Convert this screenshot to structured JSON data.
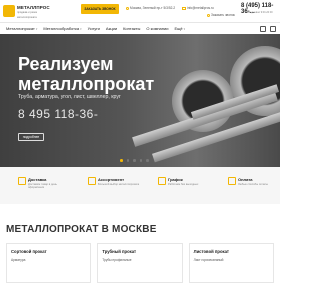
{
  "header": {
    "logo_name": "МЕТАЛЛПРОС",
    "logo_sub": "продажа и резка металлопроката",
    "cta_label": "ЗАКАЗАТЬ ЗВОНОК",
    "address": "Москва, Зеленый пр-т 5/3/52-2",
    "email": "info@metallpros.ru",
    "callback_label": "Заказать звонок",
    "phone": "8 (495) 118-36-...",
    "hours": "Ежедневно 9:00-20:00"
  },
  "nav": {
    "items": [
      "Металлопрокат",
      "Металлообработка",
      "Услуги",
      "Акции",
      "Контакты",
      "О компании",
      "Ещё"
    ]
  },
  "hero": {
    "title_line1": "Реализуем",
    "title_line2": "металлопрокат",
    "subtitle": "Труба, арматура, угол, лист, швеллер, круг",
    "phone": "8 495 118-36-",
    "button_label": "подробнее"
  },
  "features": [
    {
      "title": "Доставка",
      "desc": "Доставим товар в день оформления"
    },
    {
      "title": "Ассортимент",
      "desc": "Большой выбор металлопроката"
    },
    {
      "title": "График",
      "desc": "Работаем без выходных"
    },
    {
      "title": "Оплата",
      "desc": "Любые способы оплаты"
    }
  ],
  "catalog": {
    "title": "МЕТАЛЛОПРОКАТ В МОСКВЕ",
    "cards": [
      {
        "title": "Сортовой прокат",
        "item": "Арматура"
      },
      {
        "title": "Трубный прокат",
        "item": "Трубы профильные"
      },
      {
        "title": "Листовой прокат",
        "item": "Лист горячекатаный"
      }
    ]
  },
  "colors": {
    "accent": "#f2b705",
    "hero_bg": "#4a4a4a",
    "features_bg": "#f6f6f6"
  }
}
